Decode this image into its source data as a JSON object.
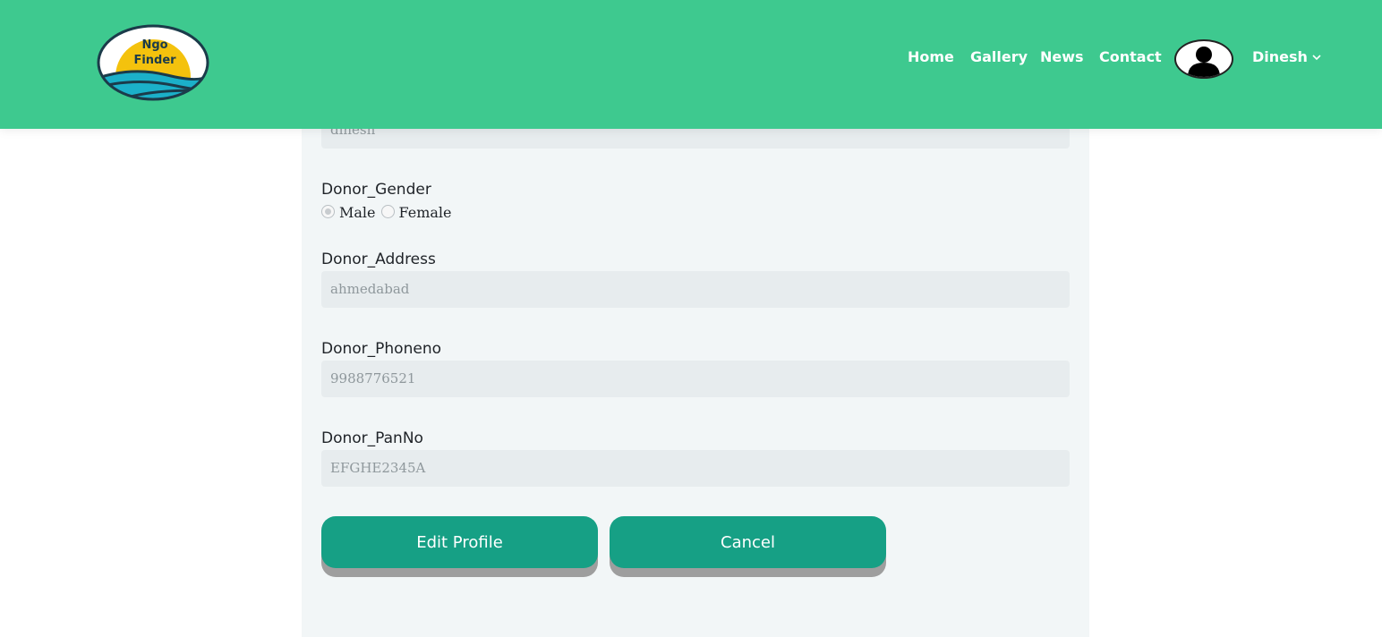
{
  "header": {
    "logo_text_line1": "Ngo",
    "logo_text_line2": "Finder",
    "nav": [
      "Home",
      "Gallery",
      "News",
      "Contact"
    ],
    "user_name": "Dinesh"
  },
  "form": {
    "name_value": "dinesh",
    "gender": {
      "label": "Donor_Gender",
      "options": [
        "Male",
        "Female"
      ],
      "selected": "Male"
    },
    "address": {
      "label": "Donor_Address",
      "value": "ahmedabad"
    },
    "phone": {
      "label": "Donor_Phoneno",
      "value": "9988776521"
    },
    "pan": {
      "label": "Donor_PanNo",
      "value": "EFGHE2345A"
    },
    "buttons": {
      "edit": "Edit Profile",
      "cancel": "Cancel"
    }
  },
  "colors": {
    "header_bg": "#3ec98f",
    "button_bg": "#16a085",
    "panel_bg": "#f2f6f7"
  }
}
